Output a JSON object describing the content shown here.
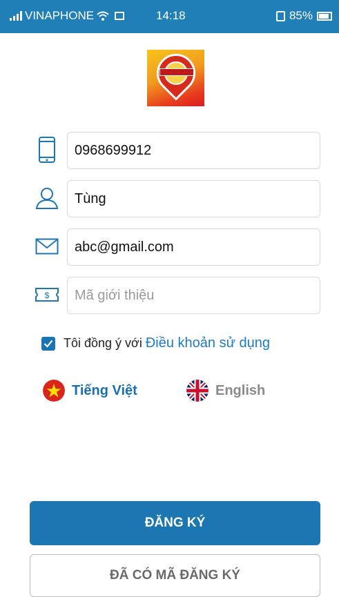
{
  "status_bar": {
    "carrier": "VINAPHONE",
    "time": "14:18",
    "battery": "85%"
  },
  "form": {
    "phone": {
      "value": "0968699912",
      "icon": "phone-icon"
    },
    "name": {
      "value": "Tùng",
      "icon": "user-icon"
    },
    "email": {
      "value": "abc@gmail.com",
      "icon": "mail-icon"
    },
    "referral": {
      "value": "",
      "placeholder": "Mã giới thiệu",
      "icon": "ticket-icon"
    }
  },
  "terms": {
    "checked": true,
    "text": "Tôi đồng ý với",
    "link": "Điều khoản sử dụng"
  },
  "languages": {
    "vietnamese": "Tiếng Việt",
    "english": "English",
    "selected": "Tiếng Việt"
  },
  "buttons": {
    "register": "ĐĂNG KÝ",
    "have_code": "ĐÃ CÓ MÃ ĐĂNG KÝ"
  },
  "colors": {
    "primary": "#1b76b2",
    "status_bar": "#1f7fb6",
    "link": "#1e7bbf"
  }
}
